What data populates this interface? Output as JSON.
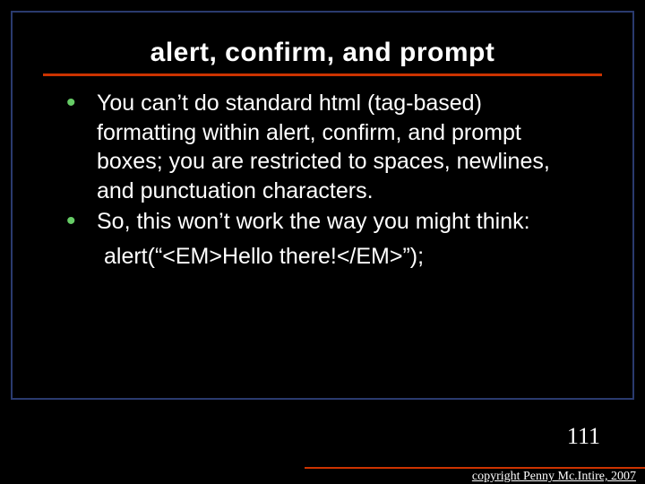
{
  "slide": {
    "title": "alert, confirm, and prompt",
    "bullets": [
      "You can’t do standard html (tag-based) formatting within alert, confirm, and prompt boxes; you are restricted to spaces, newlines, and punctuation characters.",
      "So, this won’t work the way you might think:"
    ],
    "code": "alert(“<EM>Hello there!</EM>”);",
    "page_number": "111",
    "copyright": "copyright Penny Mc.Intire, 2007",
    "colors": {
      "background": "#000000",
      "frame_border": "#2a3a6e",
      "accent_rule": "#cc3300",
      "bullet_marker": "#66cc66",
      "text": "#ffffff"
    }
  }
}
